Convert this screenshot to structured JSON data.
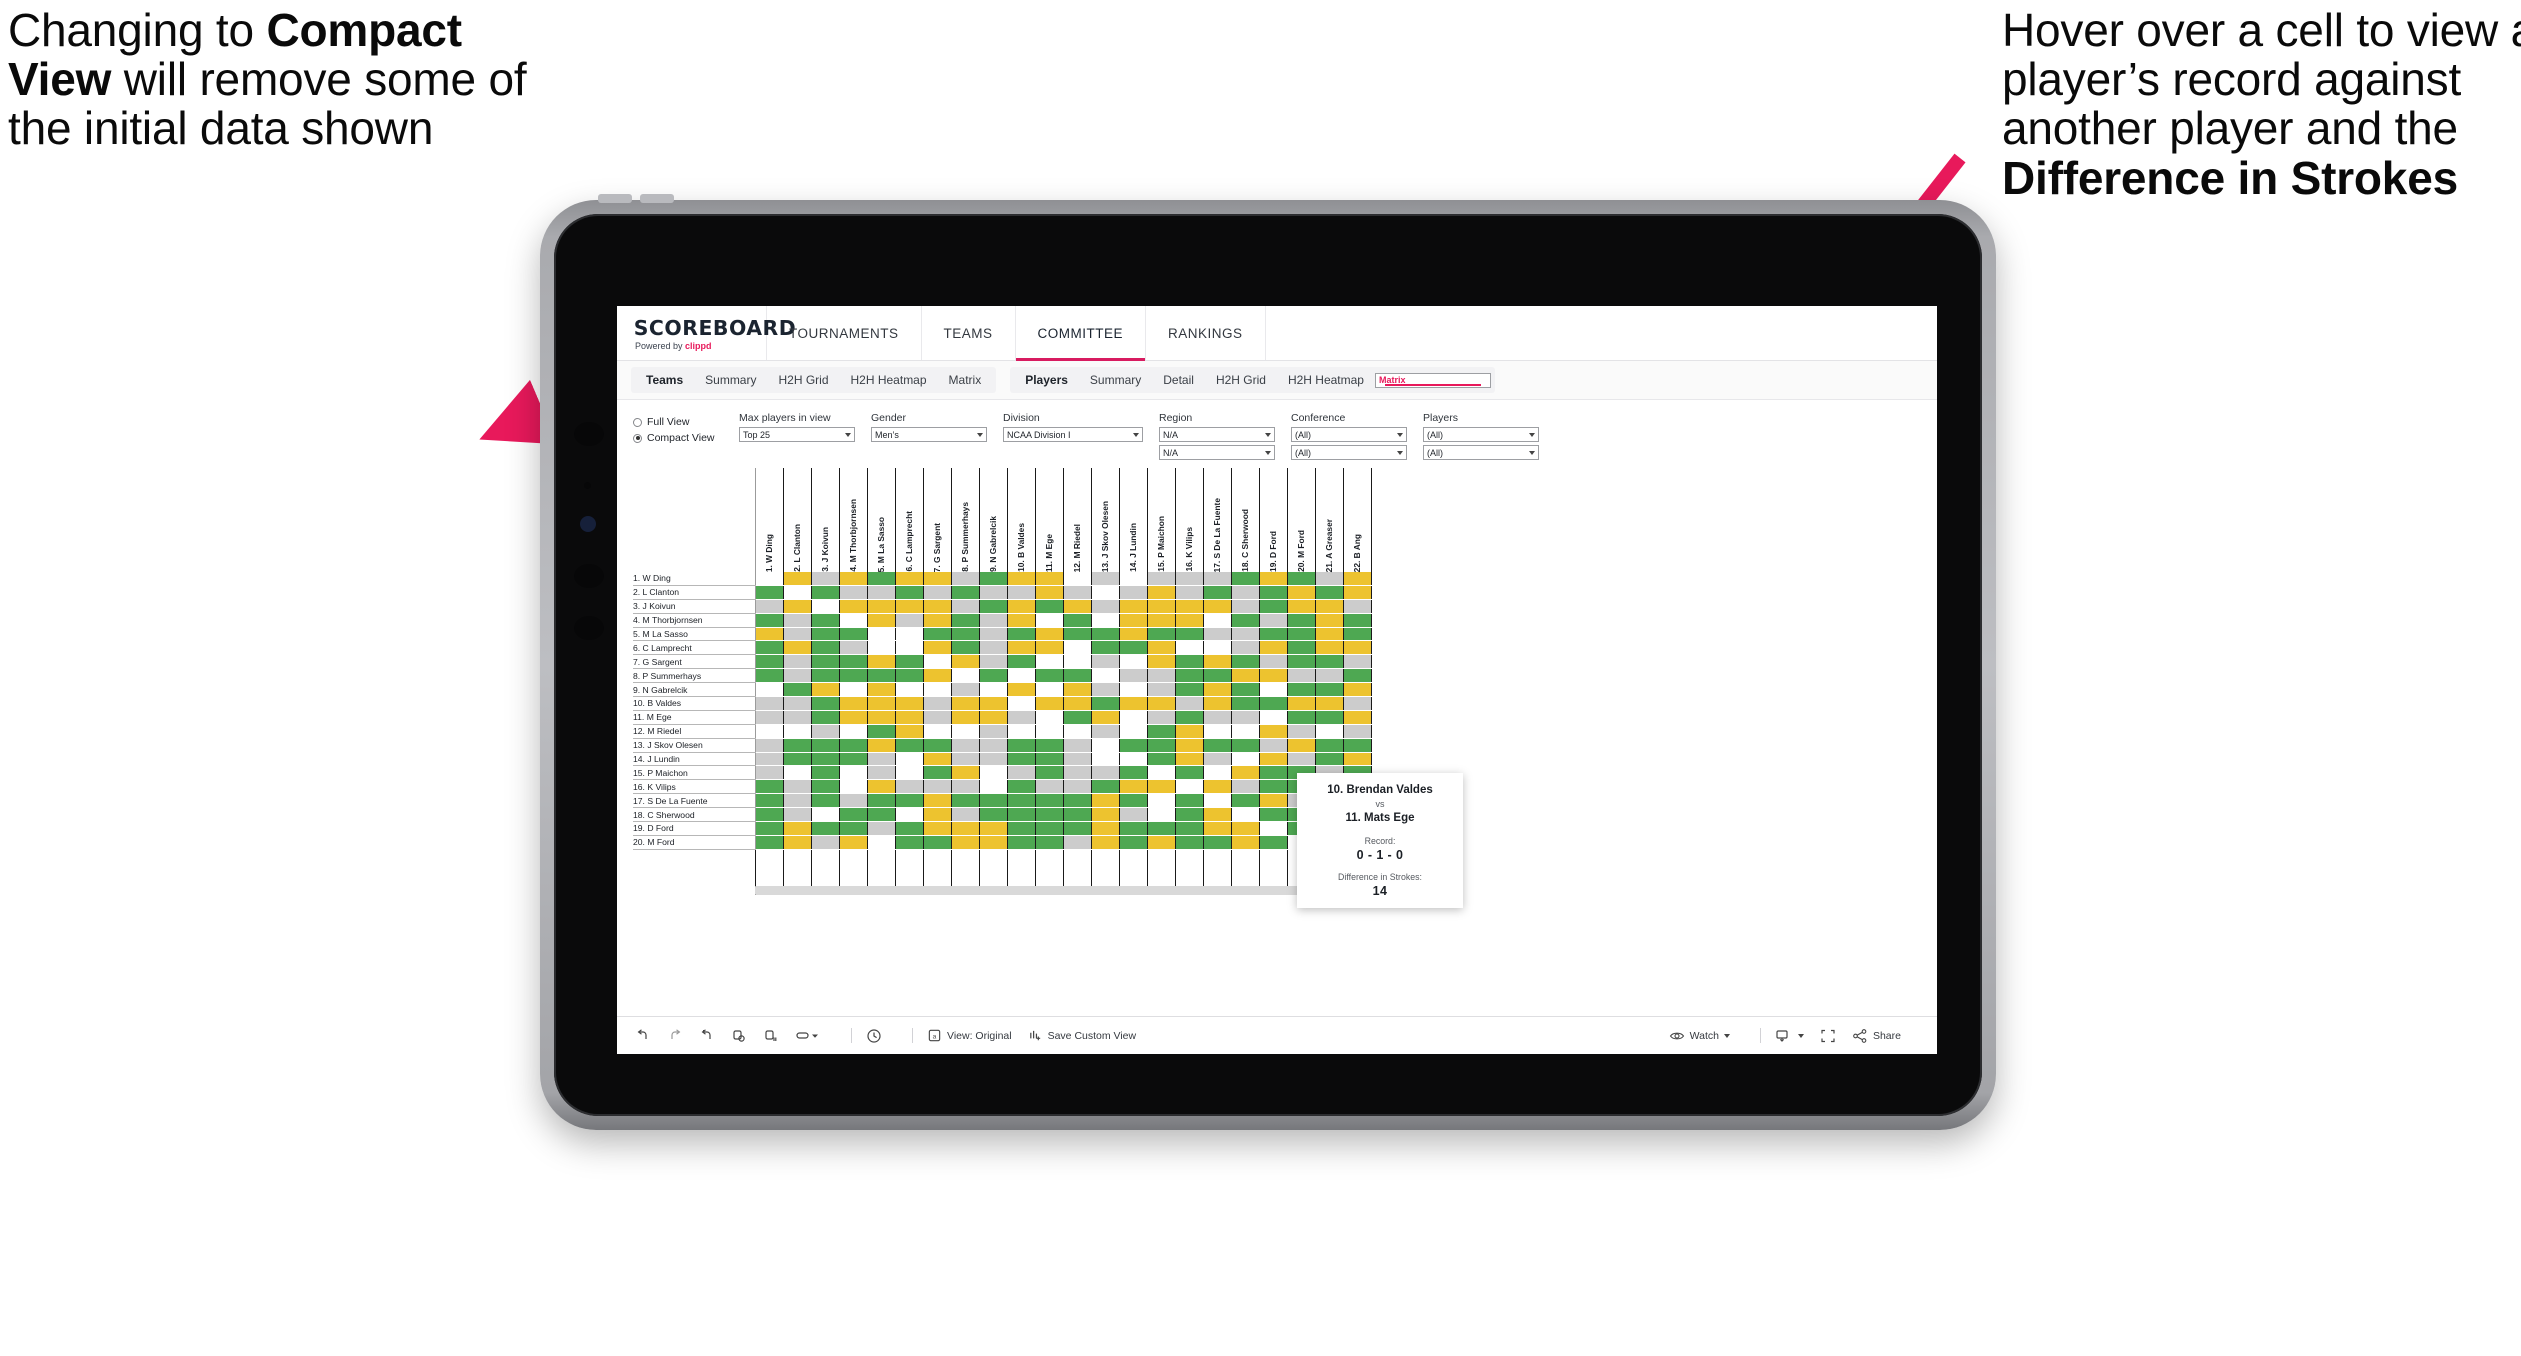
{
  "annotations": {
    "left": {
      "line1": "Changing to ",
      "bold": "Compact View",
      "line2": " will remove some of the initial data shown"
    },
    "right": {
      "line1": "Hover over a cell to view a player’s record against another player and the ",
      "bold": "Difference in Strokes"
    },
    "arrow_color": "#e8195b"
  },
  "app": {
    "brand": {
      "name": "SCOREBOARD",
      "powered_prefix": "Powered by ",
      "powered_brand": "clippd"
    },
    "topnav": [
      {
        "label": "TOURNAMENTS",
        "active": false
      },
      {
        "label": "TEAMS",
        "active": false
      },
      {
        "label": "COMMITTEE",
        "active": true
      },
      {
        "label": "RANKINGS",
        "active": false
      }
    ],
    "subnav_group1": [
      {
        "label": "Teams",
        "head": true,
        "selected": false
      },
      {
        "label": "Summary",
        "head": false,
        "selected": false
      },
      {
        "label": "H2H Grid",
        "head": false,
        "selected": false
      },
      {
        "label": "H2H Heatmap",
        "head": false,
        "selected": false
      },
      {
        "label": "Matrix",
        "head": false,
        "selected": false
      }
    ],
    "subnav_group2": [
      {
        "label": "Players",
        "head": true,
        "selected": false
      },
      {
        "label": "Summary",
        "head": false,
        "selected": false
      },
      {
        "label": "Detail",
        "head": false,
        "selected": false
      },
      {
        "label": "H2H Grid",
        "head": false,
        "selected": false
      },
      {
        "label": "H2H Heatmap",
        "head": false,
        "selected": false
      },
      {
        "label": "Matrix",
        "head": false,
        "selected": true
      }
    ]
  },
  "filters": {
    "view_mode": {
      "full_label": "Full View",
      "compact_label": "Compact View",
      "selected": "Compact View"
    },
    "max_players": {
      "label": "Max players in view",
      "value": "Top 25"
    },
    "gender": {
      "label": "Gender",
      "value": "Men’s"
    },
    "division": {
      "label": "Division",
      "value": "NCAA Division I"
    },
    "region": {
      "label": "Region",
      "value1": "N/A",
      "value2": "N/A"
    },
    "conference": {
      "label": "Conference",
      "value1": "(All)",
      "value2": "(All)"
    },
    "players": {
      "label": "Players",
      "value1": "(All)",
      "value2": "(All)"
    }
  },
  "matrix": {
    "row_labels": [
      "1. W Ding",
      "2. L Clanton",
      "3. J Koivun",
      "4. M Thorbjornsen",
      "5. M La Sasso",
      "6. C Lamprecht",
      "7. G Sargent",
      "8. P Summerhays",
      "9. N Gabrelcik",
      "10. B Valdes",
      "11. M Ege",
      "12. M Riedel",
      "13. J Skov Olesen",
      "14. J Lundin",
      "15. P Maichon",
      "16. K Vilips",
      "17. S De La Fuente",
      "18. C Sherwood",
      "19. D Ford",
      "20. M Ford"
    ],
    "col_labels": [
      "1. W Ding",
      "2. L Clanton",
      "3. J Koivun",
      "4. M Thorbjornsen",
      "5. M La Sasso",
      "6. C Lamprecht",
      "7. G Sargent",
      "8. P Summerhays",
      "9. N Gabrelcik",
      "10. B Valdes",
      "11. M Ege",
      "12. M Riedel",
      "13. J Skov Olesen",
      "14. J Lundin",
      "15. P Maichon",
      "16. K Vilips",
      "17. S De La Fuente",
      "18. C Sherwood",
      "19. D Ford",
      "20. M Ford",
      "21. A Greaser",
      "22. B Ang"
    ],
    "legend_colors": {
      "win": "#4ea852",
      "tie": "#edc32f",
      "loss": "#cccccc",
      "none": "#ffffff"
    },
    "cells": [
      [
        "w",
        "y",
        "a",
        "y",
        "g",
        "y",
        "y",
        "a",
        "g",
        "y",
        "y",
        "w",
        "a",
        "w",
        "a",
        "a",
        "a",
        "g",
        "y",
        "g",
        "a",
        "y"
      ],
      [
        "g",
        "w",
        "g",
        "a",
        "a",
        "g",
        "a",
        "g",
        "a",
        "a",
        "y",
        "a",
        "w",
        "a",
        "y",
        "a",
        "g",
        "a",
        "g",
        "y",
        "g",
        "y"
      ],
      [
        "a",
        "y",
        "w",
        "y",
        "y",
        "y",
        "y",
        "a",
        "g",
        "y",
        "g",
        "y",
        "a",
        "y",
        "y",
        "y",
        "y",
        "a",
        "g",
        "y",
        "y",
        "a"
      ],
      [
        "g",
        "a",
        "g",
        "w",
        "y",
        "a",
        "y",
        "g",
        "a",
        "y",
        "w",
        "g",
        "w",
        "y",
        "y",
        "y",
        "w",
        "g",
        "a",
        "g",
        "y",
        "g"
      ],
      [
        "y",
        "a",
        "g",
        "g",
        "w",
        "w",
        "g",
        "g",
        "a",
        "g",
        "y",
        "g",
        "g",
        "y",
        "g",
        "g",
        "a",
        "a",
        "g",
        "g",
        "y",
        "g"
      ],
      [
        "g",
        "y",
        "g",
        "a",
        "w",
        "w",
        "y",
        "g",
        "a",
        "y",
        "y",
        "w",
        "g",
        "g",
        "y",
        "w",
        "w",
        "a",
        "y",
        "g",
        "y",
        "y"
      ],
      [
        "g",
        "a",
        "g",
        "g",
        "y",
        "g",
        "w",
        "y",
        "a",
        "g",
        "w",
        "w",
        "a",
        "w",
        "y",
        "g",
        "y",
        "g",
        "a",
        "g",
        "g",
        "a"
      ],
      [
        "g",
        "a",
        "g",
        "g",
        "g",
        "g",
        "y",
        "w",
        "g",
        "w",
        "g",
        "g",
        "w",
        "a",
        "a",
        "g",
        "g",
        "y",
        "y",
        "a",
        "a",
        "g"
      ],
      [
        "w",
        "g",
        "y",
        "w",
        "y",
        "w",
        "w",
        "a",
        "w",
        "y",
        "w",
        "y",
        "a",
        "w",
        "a",
        "g",
        "y",
        "g",
        "w",
        "g",
        "g",
        "y"
      ],
      [
        "a",
        "a",
        "g",
        "y",
        "y",
        "y",
        "a",
        "y",
        "y",
        "w",
        "y",
        "y",
        "g",
        "y",
        "y",
        "a",
        "y",
        "g",
        "g",
        "y",
        "y",
        "a"
      ],
      [
        "a",
        "a",
        "g",
        "y",
        "y",
        "y",
        "a",
        "y",
        "y",
        "a",
        "w",
        "g",
        "y",
        "w",
        "a",
        "g",
        "a",
        "a",
        "w",
        "g",
        "g",
        "y"
      ],
      [
        "w",
        "w",
        "a",
        "w",
        "g",
        "y",
        "w",
        "w",
        "a",
        "w",
        "w",
        "w",
        "a",
        "w",
        "g",
        "y",
        "w",
        "w",
        "y",
        "a",
        "w",
        "a"
      ],
      [
        "a",
        "g",
        "g",
        "g",
        "y",
        "g",
        "g",
        "a",
        "a",
        "g",
        "g",
        "a",
        "w",
        "g",
        "g",
        "y",
        "g",
        "g",
        "a",
        "y",
        "g",
        "g"
      ],
      [
        "a",
        "g",
        "g",
        "g",
        "a",
        "w",
        "y",
        "a",
        "a",
        "g",
        "g",
        "a",
        "w",
        "w",
        "g",
        "y",
        "a",
        "w",
        "y",
        "a",
        "g",
        "y"
      ],
      [
        "a",
        "w",
        "g",
        "w",
        "a",
        "w",
        "g",
        "y",
        "w",
        "a",
        "g",
        "a",
        "a",
        "g",
        "w",
        "g",
        "w",
        "y",
        "g",
        "g",
        "a",
        "g"
      ],
      [
        "g",
        "a",
        "g",
        "w",
        "y",
        "a",
        "a",
        "a",
        "w",
        "g",
        "a",
        "a",
        "g",
        "y",
        "y",
        "w",
        "y",
        "a",
        "g",
        "g",
        "y",
        "g"
      ],
      [
        "g",
        "a",
        "g",
        "a",
        "g",
        "g",
        "y",
        "g",
        "g",
        "g",
        "g",
        "g",
        "y",
        "g",
        "w",
        "g",
        "w",
        "g",
        "y",
        "a",
        "g",
        "a"
      ],
      [
        "g",
        "a",
        "w",
        "g",
        "g",
        "w",
        "y",
        "a",
        "g",
        "g",
        "g",
        "g",
        "y",
        "a",
        "w",
        "g",
        "y",
        "w",
        "g",
        "g",
        "g",
        "y"
      ],
      [
        "g",
        "y",
        "g",
        "g",
        "a",
        "g",
        "y",
        "y",
        "y",
        "g",
        "g",
        "g",
        "y",
        "g",
        "g",
        "g",
        "y",
        "y",
        "w",
        "g",
        "y",
        "g"
      ],
      [
        "g",
        "y",
        "a",
        "y",
        "w",
        "g",
        "g",
        "y",
        "y",
        "g",
        "g",
        "a",
        "y",
        "g",
        "y",
        "g",
        "g",
        "y",
        "g",
        "w",
        "g",
        "g"
      ]
    ]
  },
  "tooltip": {
    "player_a": "10. Brendan Valdes",
    "vs": "vs",
    "player_b": "11. Mats Ege",
    "record_label": "Record:",
    "record_value": "0 - 1 - 0",
    "strokes_label": "Difference in Strokes:",
    "strokes_value": "14"
  },
  "toolbar": {
    "left_icons": [
      {
        "name": "undo-icon"
      },
      {
        "name": "redo-icon"
      },
      {
        "name": "revert-icon"
      },
      {
        "name": "refresh-icon"
      },
      {
        "name": "pause-icon"
      },
      {
        "name": "view-shape-icon"
      }
    ],
    "clock_label": "clock-icon",
    "view_label": "View: Original",
    "save_label": "Save Custom View",
    "watch_label": "Watch",
    "share_label": "Share"
  }
}
